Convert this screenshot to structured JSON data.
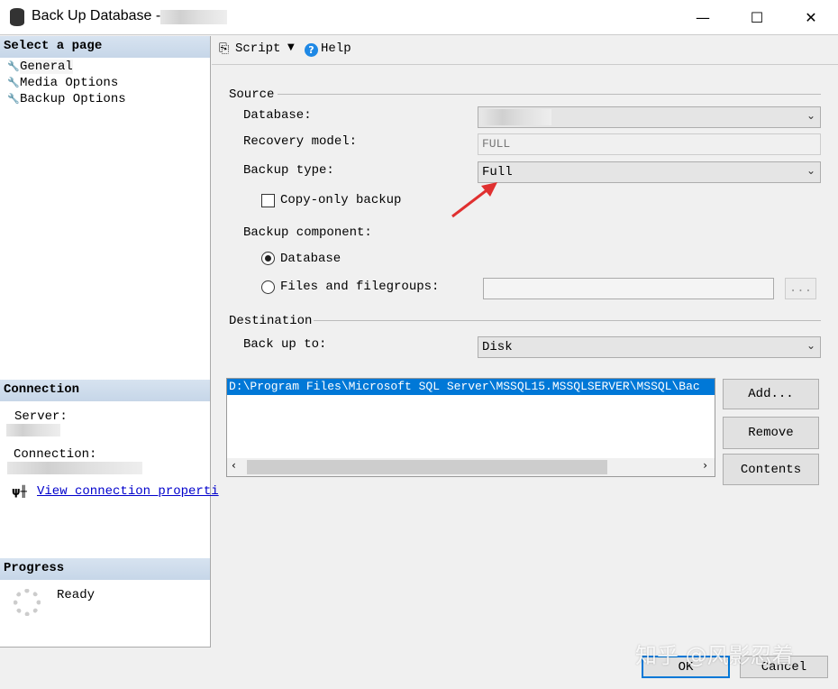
{
  "window": {
    "title": "Back Up Database -",
    "minimize": "—",
    "maximize": "☐",
    "close": "✕"
  },
  "left": {
    "select_header": "Select a page",
    "pages": [
      {
        "label": "General"
      },
      {
        "label": "Media Options"
      },
      {
        "label": "Backup Options"
      }
    ],
    "connection_header": "Connection",
    "server_label": "Server:",
    "connection_label": "Connection:",
    "view_link": "View connection properti",
    "progress_header": "Progress",
    "progress_status": "Ready"
  },
  "toolbar": {
    "script": "Script",
    "help": "Help"
  },
  "source": {
    "title": "Source",
    "database_label": "Database:",
    "recovery_label": "Recovery model:",
    "recovery_value": "FULL",
    "backup_type_label": "Backup type:",
    "backup_type_value": "Full",
    "copy_only": "Copy-only backup",
    "component_label": "Backup component:",
    "component_database": "Database",
    "component_files": "Files and filegroups:",
    "browse": "..."
  },
  "destination": {
    "title": "Destination",
    "backup_to_label": "Back up to:",
    "backup_to_value": "Disk",
    "paths": [
      "D:\\Program Files\\Microsoft SQL Server\\MSSQL15.MSSQLSERVER\\MSSQL\\Bac"
    ],
    "add": "Add...",
    "remove": "Remove",
    "contents": "Contents"
  },
  "footer": {
    "ok": "OK",
    "cancel": "Cancel"
  },
  "watermark": "知乎 @风影忍着",
  "colors": {
    "selection": "#0078d7",
    "link": "#0000cc",
    "arrow": "#e03030"
  }
}
